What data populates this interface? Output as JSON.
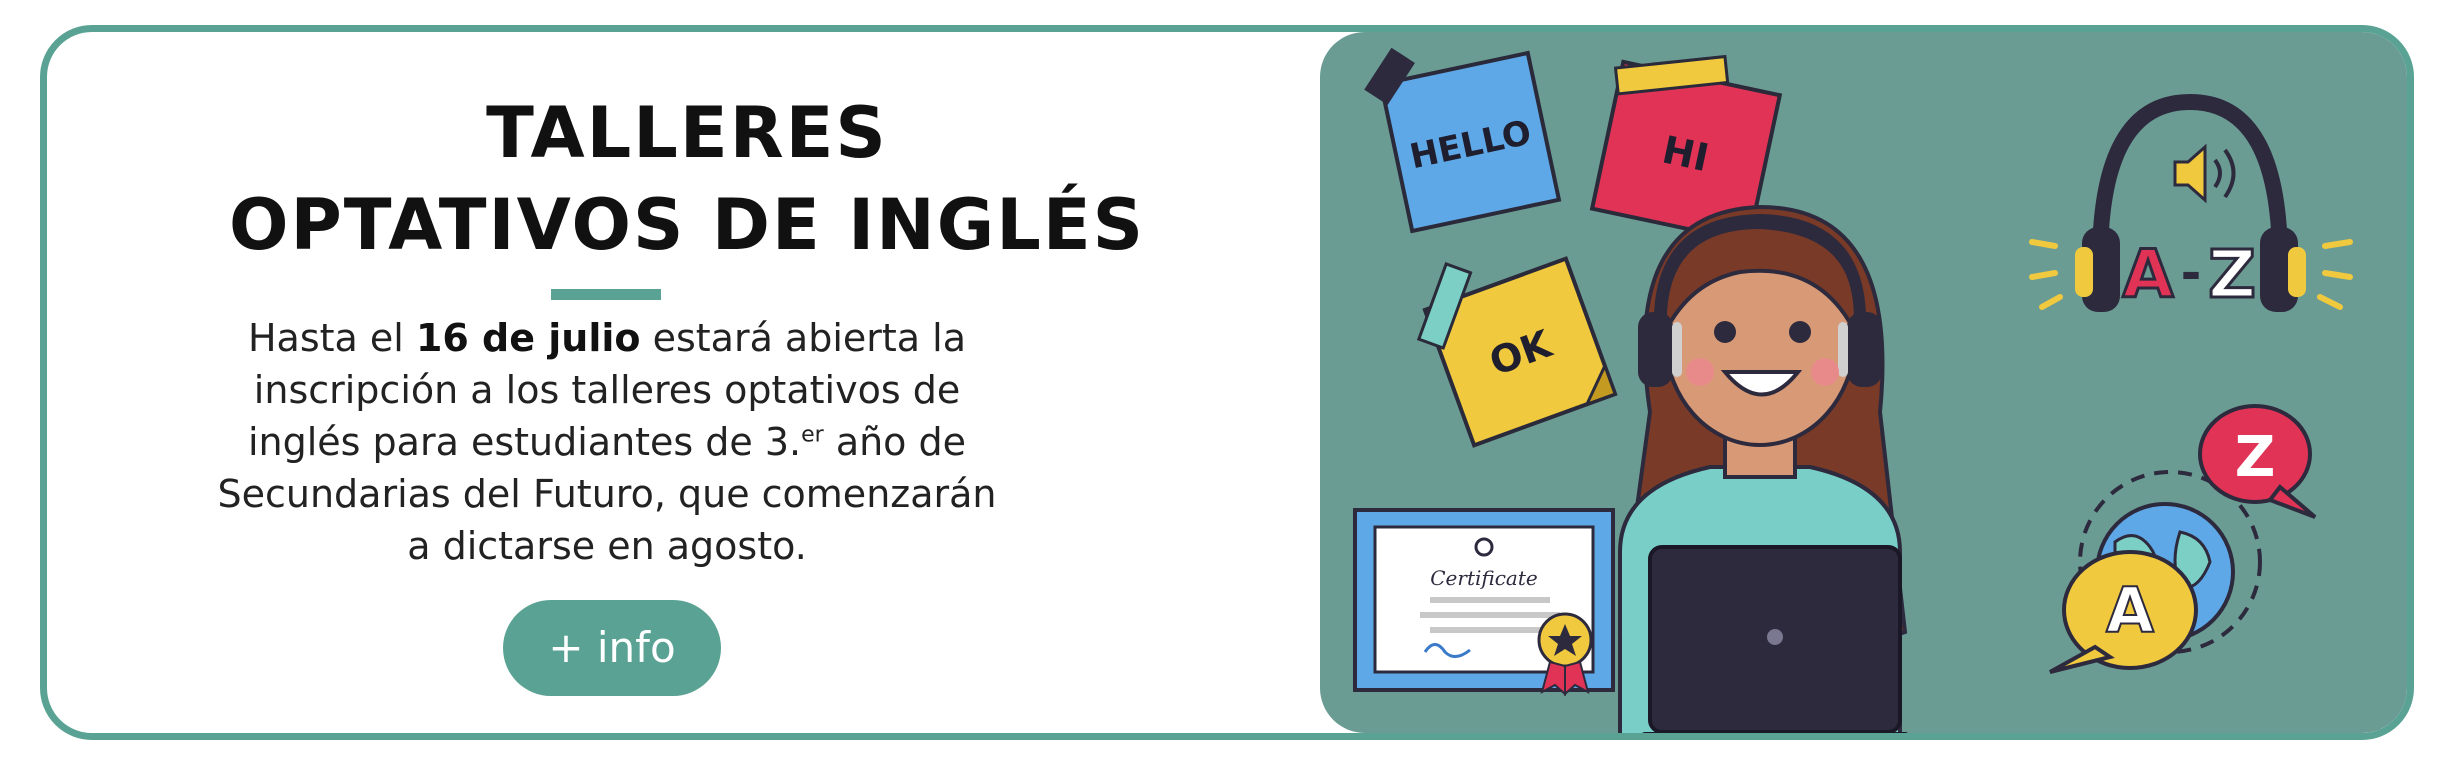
{
  "banner": {
    "title_line1": "TALLERES",
    "title_line2": "OPTATIVOS DE INGLÉS",
    "body_prefix": "Hasta el ",
    "body_bold": "16 de julio",
    "body_line1_rest": " estará abierta la",
    "body_line2": "inscripción a los talleres optativos de",
    "body_line3_pre": "inglés para estudiantes de 3.",
    "body_line3_sup": "er",
    "body_line3_post": " año de",
    "body_line4": "Secundarias del Futuro, que comenzarán",
    "body_line5": "a dictarse en agosto.",
    "button_label": "+ info"
  },
  "illustration": {
    "note_hello": "HELLO",
    "note_hi": "HI",
    "note_ok": "OK",
    "headphones_label_a": "A",
    "headphones_label_dash": "-",
    "headphones_label_z": "Z",
    "bubble_z": "Z",
    "bubble_a": "A",
    "certificate_title": "Certificate"
  },
  "colors": {
    "accent": "#5aa394",
    "panel": "#6b9c94",
    "note_blue": "#5fa8e8",
    "note_red": "#e03355",
    "note_yellow": "#f0c93e"
  }
}
